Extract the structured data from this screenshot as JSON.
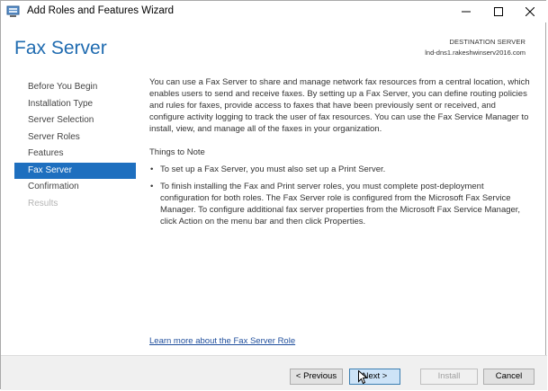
{
  "window": {
    "title": "Add Roles and Features Wizard",
    "icon": "server-manager-icon"
  },
  "header": {
    "page_title": "Fax Server",
    "destination_label": "DESTINATION SERVER",
    "destination_server": "lnd-dns1.rakeshwinserv2016.com"
  },
  "nav": {
    "items": [
      {
        "label": "Before You Begin",
        "state": "normal"
      },
      {
        "label": "Installation Type",
        "state": "normal"
      },
      {
        "label": "Server Selection",
        "state": "normal"
      },
      {
        "label": "Server Roles",
        "state": "normal"
      },
      {
        "label": "Features",
        "state": "normal"
      },
      {
        "label": "Fax Server",
        "state": "active"
      },
      {
        "label": "Confirmation",
        "state": "normal"
      },
      {
        "label": "Results",
        "state": "disabled"
      }
    ]
  },
  "content": {
    "intro": "You can use a Fax Server to share and manage network fax resources from a central location, which enables users to send and receive faxes. By setting up a Fax Server, you can define routing policies and rules for faxes, provide access to faxes that have been previously sent or received, and configure activity logging to track the user of fax resources. You can use the Fax Service Manager to install, view, and manage all of the faxes in your organization.",
    "notes_heading": "Things to Note",
    "bullet_char": "•",
    "notes": [
      "To set up a Fax Server, you must also set up a Print Server.",
      "To finish installing the Fax and Print server roles, you must complete post-deployment configuration for both roles. The Fax Server role is configured from the Microsoft Fax Service Manager. To configure additional fax server properties from the Microsoft Fax Service Manager, click Action on the menu bar and then click Properties."
    ],
    "learn_more_link": "Learn more about the Fax Server Role"
  },
  "footer": {
    "previous_label": "< Previous",
    "next_label": "Next >",
    "install_label": "Install",
    "cancel_label": "Cancel"
  },
  "colors": {
    "accent": "#1e6fbf",
    "title_blue": "#1f6bb0",
    "link_blue": "#1f4e9c"
  }
}
